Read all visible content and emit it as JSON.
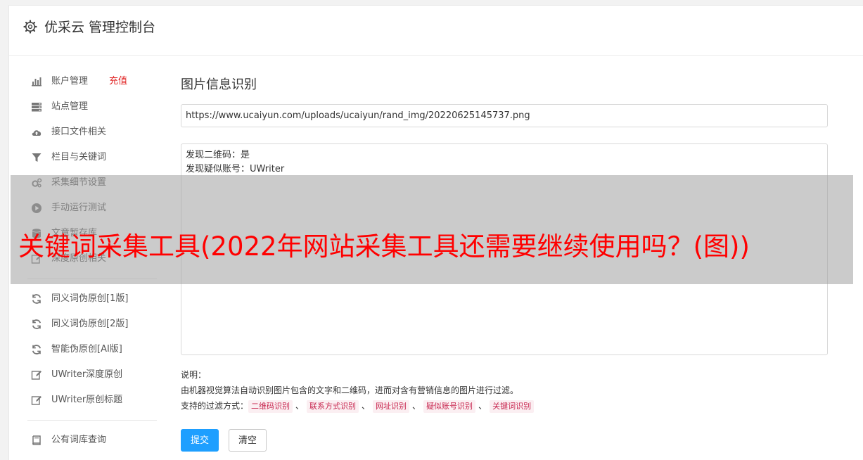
{
  "header": {
    "title": "优采云 管理控制台",
    "icon": "gear-icon"
  },
  "sidebar": {
    "groups": [
      [
        {
          "label": "账户管理",
          "extra": "充值",
          "icon": "bar-chart-icon"
        },
        {
          "label": "站点管理",
          "icon": "server-icon"
        },
        {
          "label": "接口文件相关",
          "icon": "cloud-upload-icon"
        },
        {
          "label": "栏目与关键词",
          "icon": "filter-icon"
        },
        {
          "label": "采集细节设置",
          "icon": "cogs-icon"
        },
        {
          "label": "手动运行测试",
          "icon": "play-circle-icon"
        },
        {
          "label": "文章暂存库",
          "icon": "database-icon"
        },
        {
          "label": "深度原创相关",
          "icon": "edit-icon"
        }
      ],
      [
        {
          "label": "同义词伪原创[1版]",
          "icon": "refresh-icon"
        },
        {
          "label": "同义词伪原创[2版]",
          "icon": "refresh-icon"
        },
        {
          "label": "智能伪原创[AI版]",
          "icon": "refresh-icon"
        },
        {
          "label": "UWriter深度原创",
          "icon": "edit-icon"
        },
        {
          "label": "UWriter原创标题",
          "icon": "edit-icon"
        }
      ],
      [
        {
          "label": "公有词库查询",
          "icon": "book-icon"
        }
      ]
    ]
  },
  "main": {
    "heading": "图片信息识别",
    "url_value": "https://www.ucaiyun.com/uploads/ucaiyun/rand_img/20220625145737.png",
    "result_lines": [
      "发现二维码：是",
      "发现疑似账号：UWriter"
    ],
    "note": {
      "label": "说明：",
      "description": "由机器视觉算法自动识别图片包含的文字和二维码，进而对含有营销信息的图片进行过滤。",
      "methods_label": "支持的过滤方式：",
      "methods": [
        "二维码识别",
        "联系方式识别",
        "网址识别",
        "疑似账号识别",
        "关键词识别"
      ],
      "separator": "、"
    },
    "submit_label": "提交",
    "clear_label": "清空"
  },
  "overlay": {
    "text": "关键词采集工具(2022年网站采集工具还需要继续使用吗？(图))"
  },
  "colors": {
    "primary": "#1e9fff",
    "accent_red": "#e02020",
    "tag_text": "#c7254e",
    "tag_bg": "#fbeff2",
    "overlay_text": "#ff0000"
  }
}
